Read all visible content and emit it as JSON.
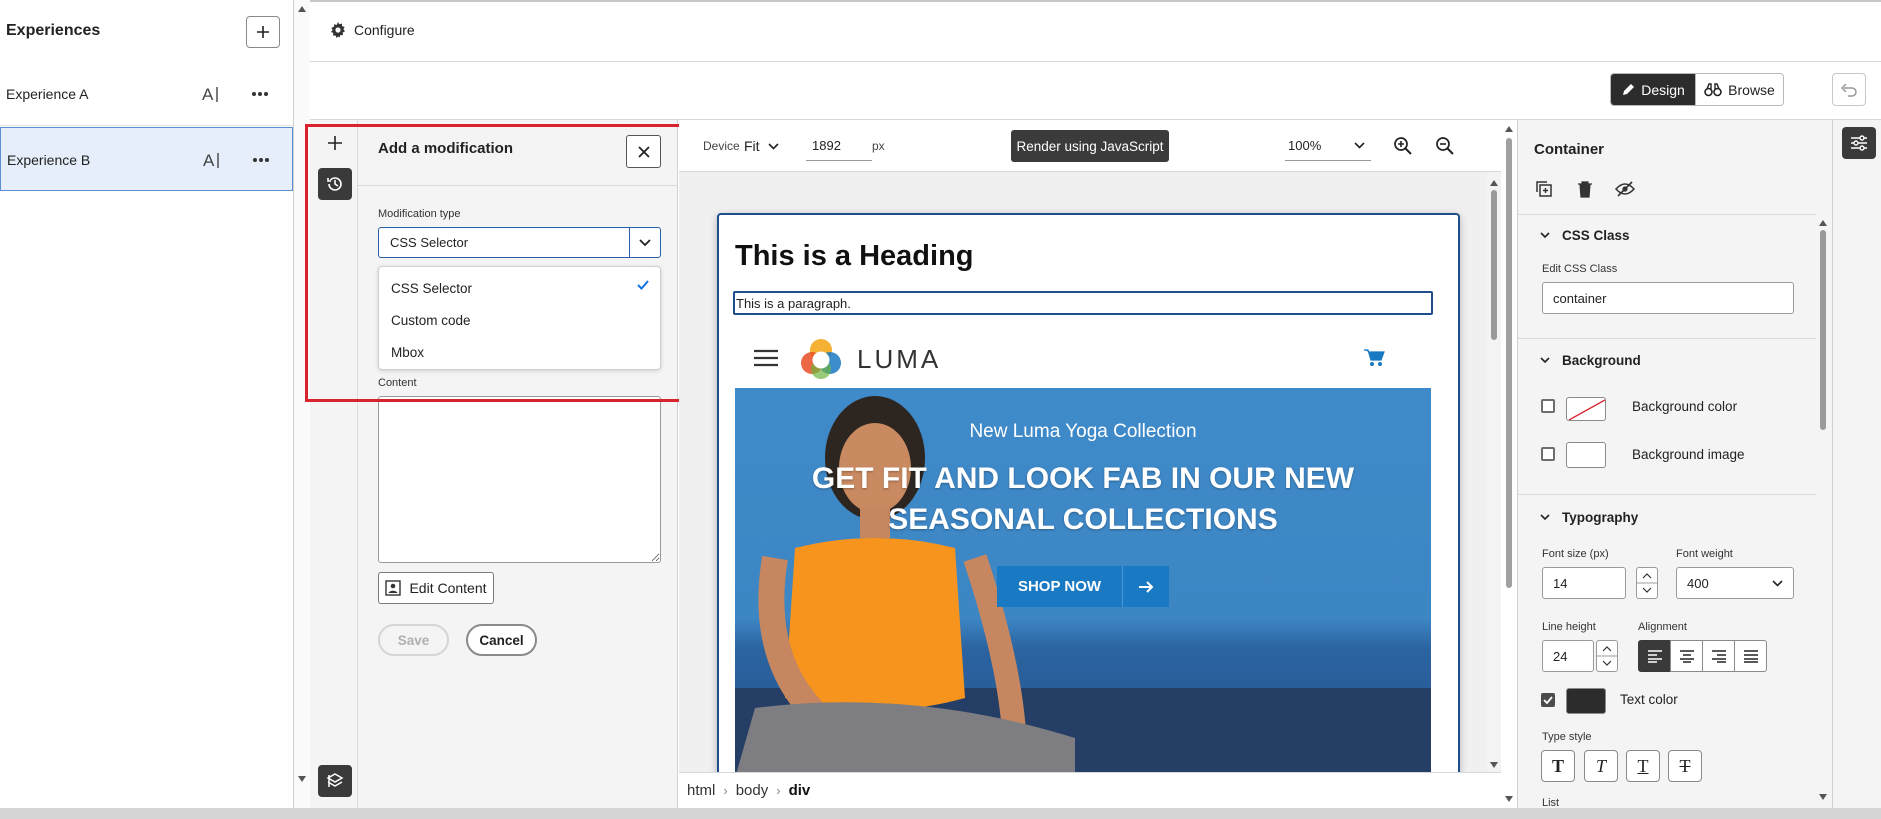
{
  "experiences_panel": {
    "title": "Experiences",
    "items": [
      {
        "label": "Experience A"
      },
      {
        "label": "Experience B"
      }
    ]
  },
  "topbar": {
    "configure_label": "Configure",
    "design_label": "Design",
    "browse_label": "Browse"
  },
  "modification_panel": {
    "title": "Add a modification",
    "type_label": "Modification type",
    "type_value": "CSS Selector",
    "options": [
      "CSS Selector",
      "Custom code",
      "Mbox"
    ],
    "selected_option": "CSS Selector",
    "content_label": "Content",
    "edit_content_label": "Edit Content",
    "save_label": "Save",
    "cancel_label": "Cancel"
  },
  "canvas_toolbar": {
    "device_label": "Device",
    "device_value": "Fit",
    "width_value": "1892",
    "width_unit": "px",
    "render_label": "Render using JavaScript",
    "zoom_value": "100%"
  },
  "preview": {
    "heading": "This is a Heading",
    "paragraph": "This is a paragraph.",
    "logo_text": "LUMA",
    "hero_subtitle": "New Luma Yoga Collection",
    "hero_title": "GET FIT AND LOOK FAB IN OUR NEW SEASONAL COLLECTIONS",
    "cta_label": "SHOP NOW"
  },
  "breadcrumb": [
    "html",
    "body",
    "div"
  ],
  "properties_panel": {
    "title": "Container",
    "css_class": {
      "section_title": "CSS Class",
      "field_label": "Edit CSS Class",
      "value": "container"
    },
    "background": {
      "section_title": "Background",
      "color_label": "Background color",
      "image_label": "Background image"
    },
    "typography": {
      "section_title": "Typography",
      "font_size_label": "Font size (px)",
      "font_size_value": "14",
      "font_weight_label": "Font weight",
      "font_weight_value": "400",
      "line_height_label": "Line height",
      "line_height_value": "24",
      "alignment_label": "Alignment",
      "text_color_label": "Text color",
      "text_color": "#2c2c2c",
      "type_style_label": "Type style",
      "list_label": "List"
    }
  },
  "colors": {
    "highlight": "#d9232e",
    "accent_blue": "#1979c3",
    "dark_button": "#2c2c2c"
  }
}
